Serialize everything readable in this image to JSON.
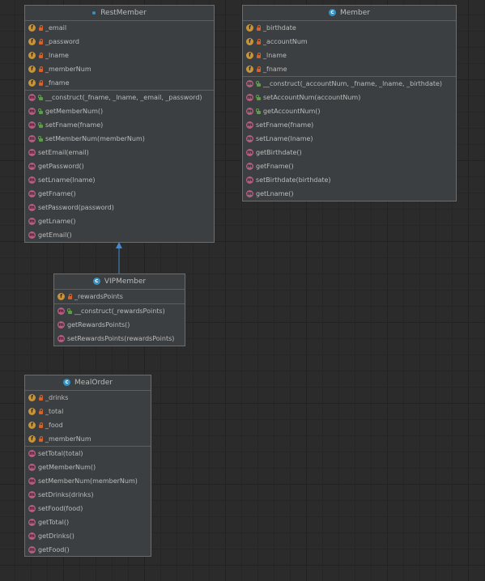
{
  "classes": {
    "restmember": {
      "name": "RestMember",
      "fields": [
        {
          "text": "_email",
          "icon": "f",
          "access": "private"
        },
        {
          "text": "_password",
          "icon": "f",
          "access": "private"
        },
        {
          "text": "_lname",
          "icon": "f",
          "access": "private"
        },
        {
          "text": "_memberNum",
          "icon": "f",
          "access": "private"
        },
        {
          "text": "_fname",
          "icon": "f",
          "access": "private"
        }
      ],
      "methods": [
        {
          "text": "__construct(_fname, _lname, _email, _password)",
          "icon": "m",
          "access": "public"
        },
        {
          "text": "getMemberNum()",
          "icon": "m",
          "access": "public"
        },
        {
          "text": "setFname(fname)",
          "icon": "m",
          "access": "public"
        },
        {
          "text": "setMemberNum(memberNum)",
          "icon": "m",
          "access": "public"
        },
        {
          "text": "setEmail(email)",
          "icon": "m",
          "access": "none"
        },
        {
          "text": "getPassword()",
          "icon": "m",
          "access": "none"
        },
        {
          "text": "setLname(lname)",
          "icon": "m",
          "access": "none"
        },
        {
          "text": "getFname()",
          "icon": "m",
          "access": "none"
        },
        {
          "text": "setPassword(password)",
          "icon": "m",
          "access": "none"
        },
        {
          "text": "getLname()",
          "icon": "m",
          "access": "none"
        },
        {
          "text": "getEmail()",
          "icon": "m",
          "access": "none"
        }
      ]
    },
    "member": {
      "name": "Member",
      "fields": [
        {
          "text": "_birthdate",
          "icon": "f",
          "access": "private"
        },
        {
          "text": "_accountNum",
          "icon": "f",
          "access": "private"
        },
        {
          "text": "_lname",
          "icon": "f",
          "access": "private"
        },
        {
          "text": "_fname",
          "icon": "f",
          "access": "private"
        }
      ],
      "methods": [
        {
          "text": "__construct(_accountNum, _fname, _lname, _birthdate)",
          "icon": "m",
          "access": "public"
        },
        {
          "text": "setAccountNum(accountNum)",
          "icon": "m",
          "access": "public"
        },
        {
          "text": "getAccountNum()",
          "icon": "m",
          "access": "public"
        },
        {
          "text": "setFname(fname)",
          "icon": "m",
          "access": "none"
        },
        {
          "text": "setLname(lname)",
          "icon": "m",
          "access": "none"
        },
        {
          "text": "getBirthdate()",
          "icon": "m",
          "access": "none"
        },
        {
          "text": "getFname()",
          "icon": "m",
          "access": "none"
        },
        {
          "text": "setBirthdate(birthdate)",
          "icon": "m",
          "access": "none"
        },
        {
          "text": "getLname()",
          "icon": "m",
          "access": "none"
        }
      ]
    },
    "vipmember": {
      "name": "VIPMember",
      "fields": [
        {
          "text": "_rewardsPoints",
          "icon": "f",
          "access": "private"
        }
      ],
      "methods": [
        {
          "text": "__construct(_rewardsPoints)",
          "icon": "m",
          "access": "public"
        },
        {
          "text": "getRewardsPoints()",
          "icon": "m",
          "access": "none"
        },
        {
          "text": "setRewardsPoints(rewardsPoints)",
          "icon": "m",
          "access": "none"
        }
      ]
    },
    "mealorder": {
      "name": "MealOrder",
      "fields": [
        {
          "text": "_drinks",
          "icon": "f",
          "access": "private"
        },
        {
          "text": "_total",
          "icon": "f",
          "access": "private"
        },
        {
          "text": "_food",
          "icon": "f",
          "access": "private"
        },
        {
          "text": "_memberNum",
          "icon": "f",
          "access": "private"
        }
      ],
      "methods": [
        {
          "text": "setTotal(total)",
          "icon": "m",
          "access": "none"
        },
        {
          "text": "getMemberNum()",
          "icon": "m",
          "access": "none"
        },
        {
          "text": "setMemberNum(memberNum)",
          "icon": "m",
          "access": "none"
        },
        {
          "text": "setDrinks(drinks)",
          "icon": "m",
          "access": "none"
        },
        {
          "text": "setFood(food)",
          "icon": "m",
          "access": "none"
        },
        {
          "text": "getTotal()",
          "icon": "m",
          "access": "none"
        },
        {
          "text": "getDrinks()",
          "icon": "m",
          "access": "none"
        },
        {
          "text": "getFood()",
          "icon": "m",
          "access": "none"
        }
      ]
    }
  },
  "relations": [
    {
      "from": "VIPMember",
      "to": "RestMember",
      "kind": "inheritance"
    }
  ],
  "colors": {
    "field_icon": "#c7943a",
    "method_icon": "#b55e7f",
    "class_icon": "#3592c4",
    "private_lock": "#d6622b",
    "public_lock": "#5c9d47",
    "inheritance_arrow": "#4a88c7"
  }
}
